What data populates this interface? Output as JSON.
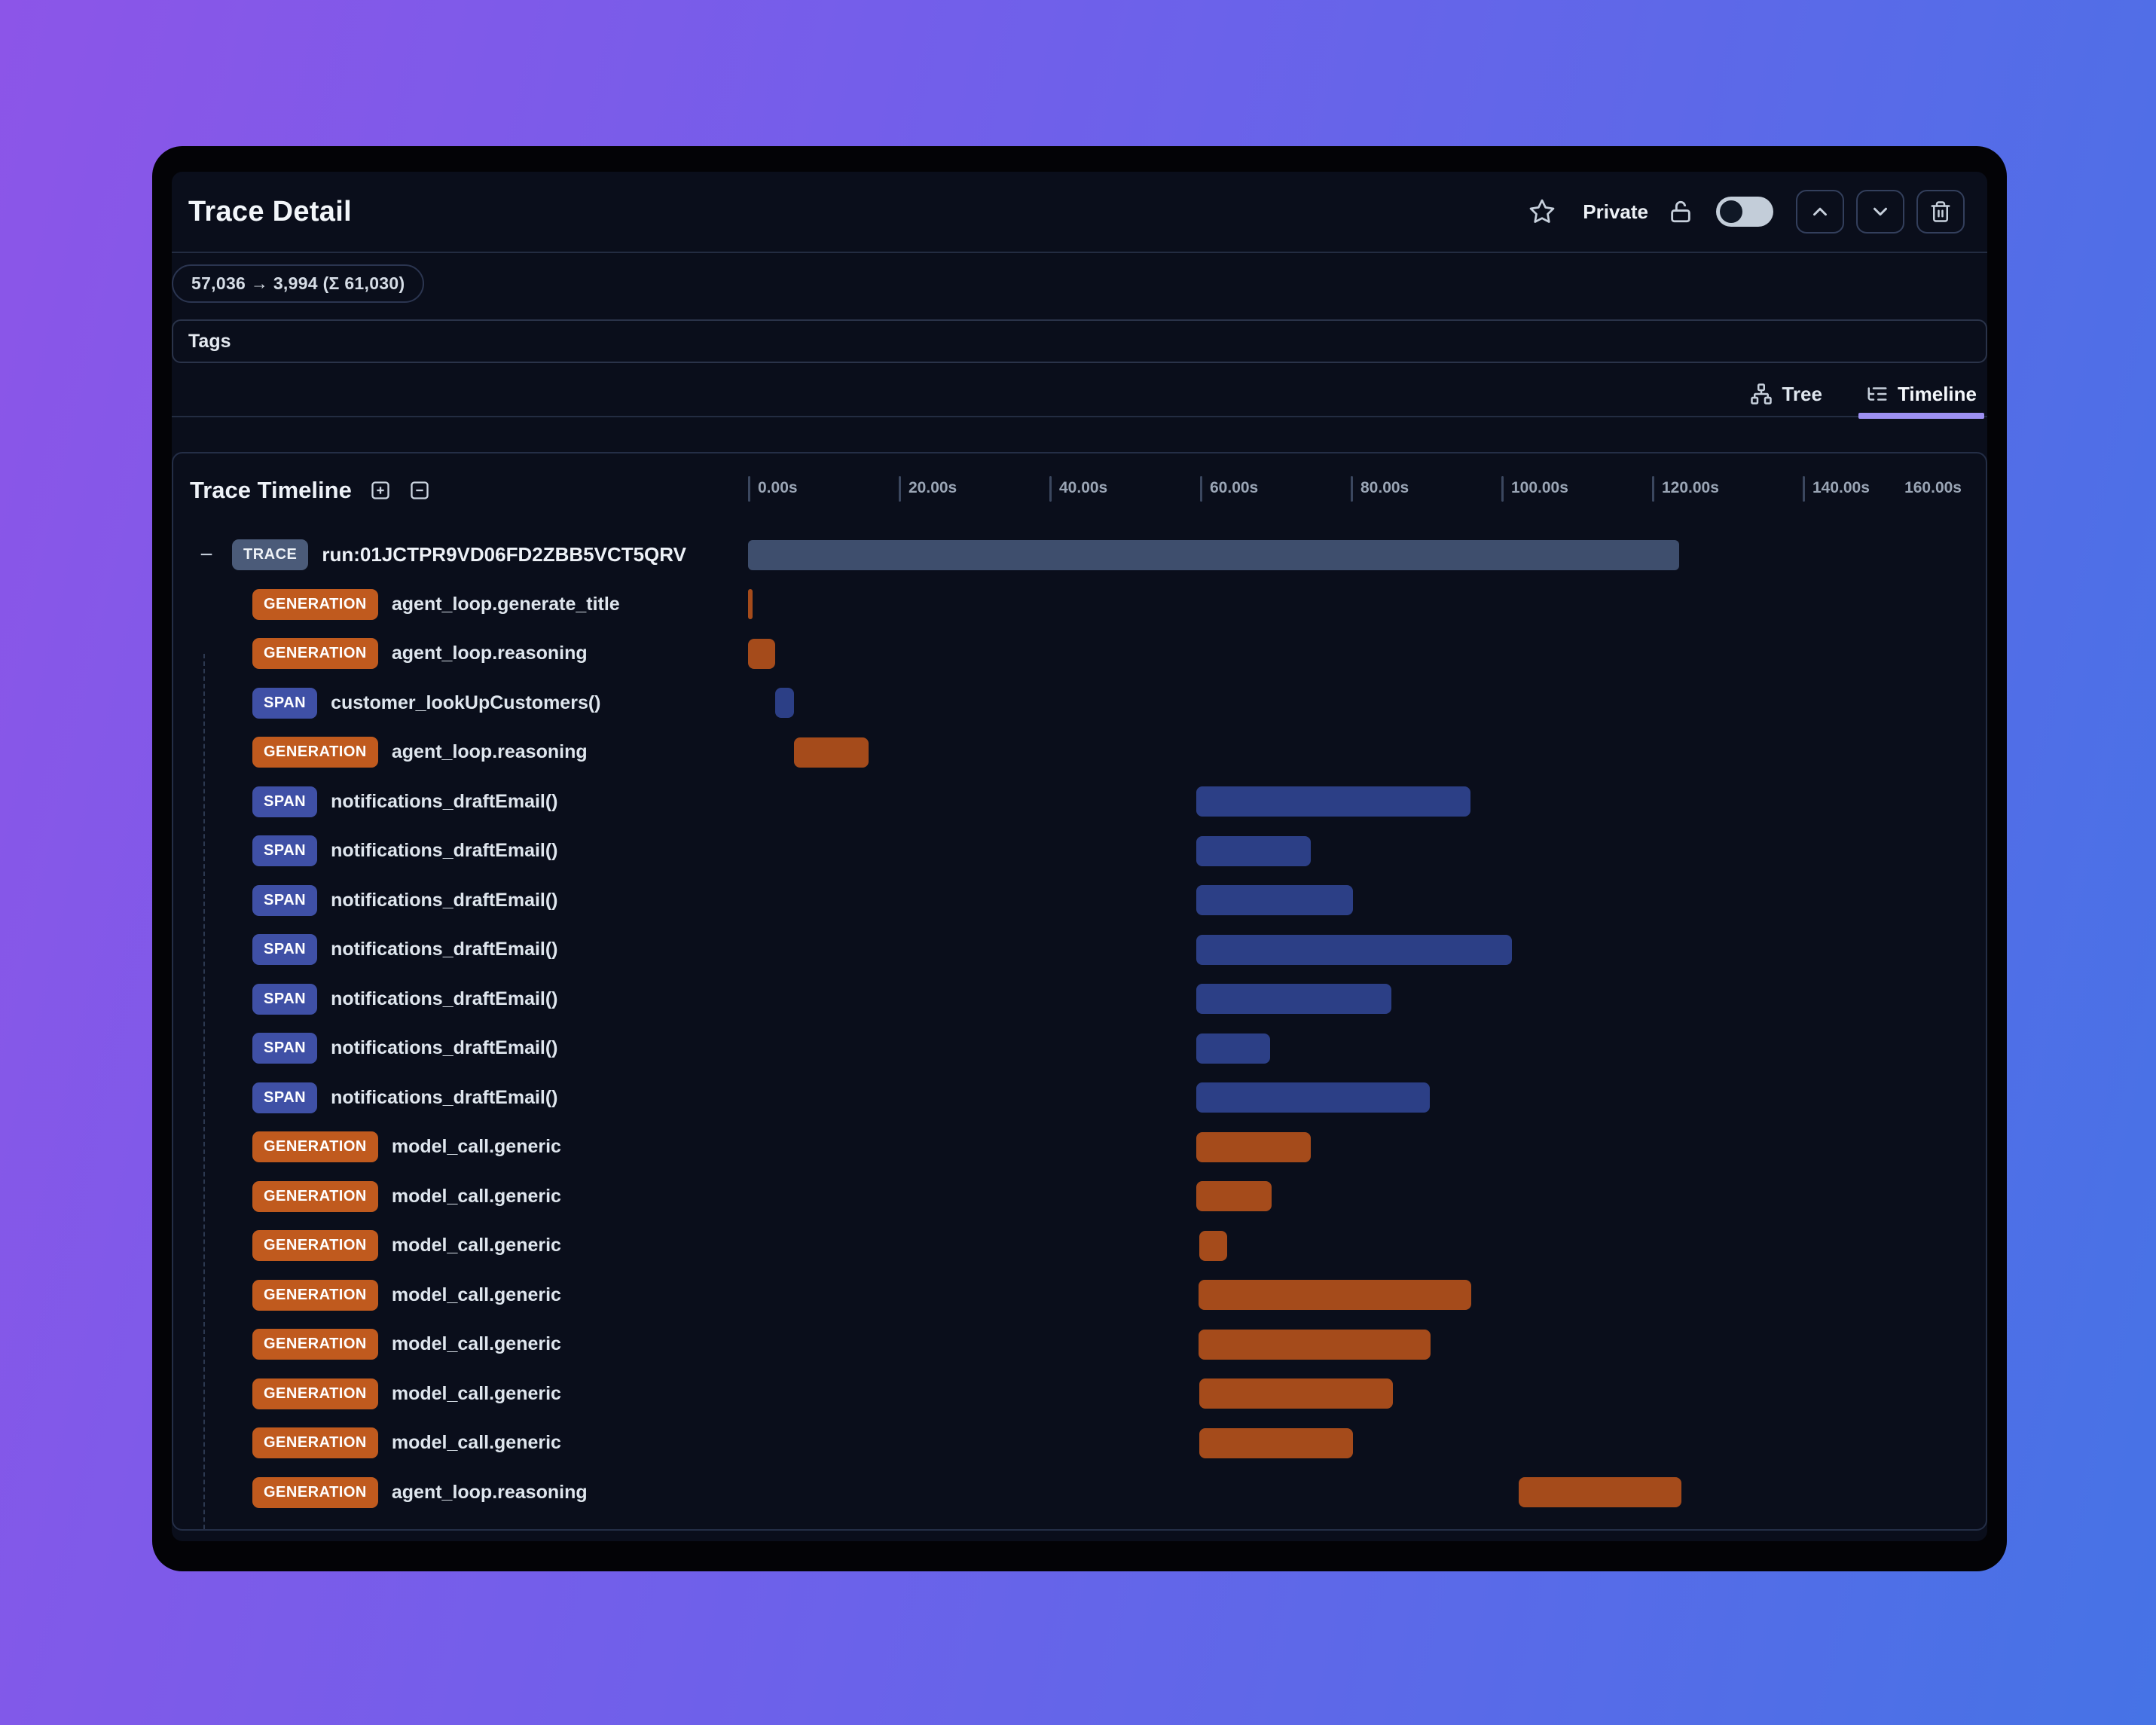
{
  "header": {
    "title": "Trace Detail",
    "privacy_label": "Private"
  },
  "token_usage": "57,036 → 3,994 (Σ 61,030)",
  "tags": {
    "label": "Tags"
  },
  "view_tabs": {
    "tree_label": "Tree",
    "timeline_label": "Timeline",
    "active": "Timeline"
  },
  "timeline": {
    "title": "Trace Timeline",
    "axis": {
      "tick_labels": [
        "0.00s",
        "20.00s",
        "40.00s",
        "60.00s",
        "80.00s",
        "100.00s",
        "120.00s",
        "140.00s"
      ],
      "end_label": "160.00s",
      "seconds_per_tick": 20,
      "max_seconds": 160
    },
    "rows": [
      {
        "type": "TRACE",
        "label": "run:01JCTPR9VD06FD2ZBB5VCT5QRV",
        "start_s": 0.0,
        "end_s": 123.6,
        "depth": 0
      },
      {
        "type": "GENERATION",
        "label": "agent_loop.generate_title",
        "start_s": 0.0,
        "end_s": 0.6,
        "depth": 1
      },
      {
        "type": "GENERATION",
        "label": "agent_loop.reasoning",
        "start_s": 0.0,
        "end_s": 3.6,
        "depth": 1
      },
      {
        "type": "SPAN",
        "label": "customer_lookUpCustomers()",
        "start_s": 3.6,
        "end_s": 6.1,
        "depth": 1
      },
      {
        "type": "GENERATION",
        "label": "agent_loop.reasoning",
        "start_s": 6.1,
        "end_s": 16.0,
        "depth": 1
      },
      {
        "type": "SPAN",
        "label": "notifications_draftEmail()",
        "start_s": 59.5,
        "end_s": 95.9,
        "depth": 1
      },
      {
        "type": "SPAN",
        "label": "notifications_draftEmail()",
        "start_s": 59.5,
        "end_s": 74.7,
        "depth": 1
      },
      {
        "type": "SPAN",
        "label": "notifications_draftEmail()",
        "start_s": 59.5,
        "end_s": 80.3,
        "depth": 1
      },
      {
        "type": "SPAN",
        "label": "notifications_draftEmail()",
        "start_s": 59.5,
        "end_s": 101.4,
        "depth": 1
      },
      {
        "type": "SPAN",
        "label": "notifications_draftEmail()",
        "start_s": 59.5,
        "end_s": 85.4,
        "depth": 1
      },
      {
        "type": "SPAN",
        "label": "notifications_draftEmail()",
        "start_s": 59.5,
        "end_s": 69.3,
        "depth": 1
      },
      {
        "type": "SPAN",
        "label": "notifications_draftEmail()",
        "start_s": 59.5,
        "end_s": 90.5,
        "depth": 1
      },
      {
        "type": "GENERATION",
        "label": "model_call.generic",
        "start_s": 59.5,
        "end_s": 74.7,
        "depth": 1
      },
      {
        "type": "GENERATION",
        "label": "model_call.generic",
        "start_s": 59.5,
        "end_s": 69.5,
        "depth": 1
      },
      {
        "type": "GENERATION",
        "label": "model_call.generic",
        "start_s": 59.9,
        "end_s": 63.6,
        "depth": 1
      },
      {
        "type": "GENERATION",
        "label": "model_call.generic",
        "start_s": 59.8,
        "end_s": 96.0,
        "depth": 1
      },
      {
        "type": "GENERATION",
        "label": "model_call.generic",
        "start_s": 59.8,
        "end_s": 90.6,
        "depth": 1
      },
      {
        "type": "GENERATION",
        "label": "model_call.generic",
        "start_s": 59.9,
        "end_s": 85.6,
        "depth": 1
      },
      {
        "type": "GENERATION",
        "label": "model_call.generic",
        "start_s": 59.9,
        "end_s": 80.3,
        "depth": 1
      },
      {
        "type": "GENERATION",
        "label": "agent_loop.reasoning",
        "start_s": 102.3,
        "end_s": 123.9,
        "depth": 1
      }
    ]
  },
  "colors": {
    "accent_underline": "#9d90f2",
    "badge_generation": "#c05a1e",
    "badge_span": "#3f50a6",
    "badge_trace": "#4b5b79",
    "bar_generation": "#a54b1b",
    "bar_span": "#2c3f86",
    "bar_trace": "#3e4e6d",
    "gradient_start": "#8c55e8",
    "gradient_mid": "#6f60ea",
    "gradient_end": "#4673e6"
  }
}
